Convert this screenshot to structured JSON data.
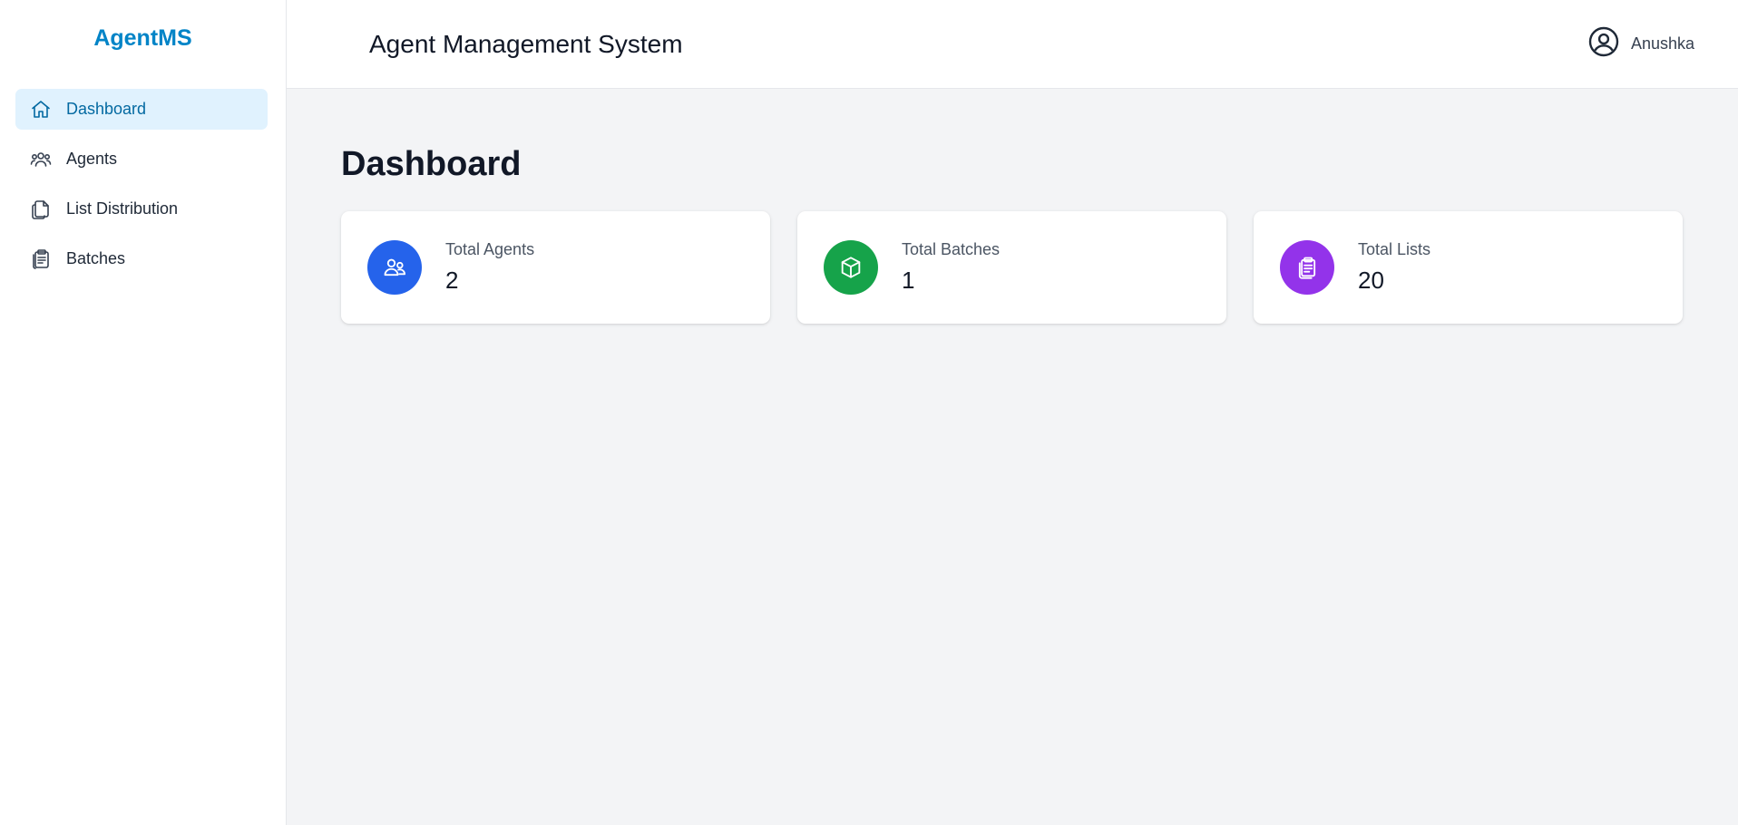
{
  "brand": "AgentMS",
  "sidebar": {
    "items": [
      {
        "label": "Dashboard",
        "icon": "home-icon",
        "active": true
      },
      {
        "label": "Agents",
        "icon": "users-icon",
        "active": false
      },
      {
        "label": "List Distribution",
        "icon": "documents-icon",
        "active": false
      },
      {
        "label": "Batches",
        "icon": "clipboard-icon",
        "active": false
      }
    ]
  },
  "header": {
    "title": "Agent Management System",
    "user_name": "Anushka"
  },
  "page": {
    "title": "Dashboard",
    "cards": [
      {
        "label": "Total Agents",
        "value": "2",
        "icon": "users-icon",
        "color": "#2563eb"
      },
      {
        "label": "Total Batches",
        "value": "1",
        "icon": "cube-icon",
        "color": "#16a34a"
      },
      {
        "label": "Total Lists",
        "value": "20",
        "icon": "clipboard-icon",
        "color": "#9333ea"
      }
    ]
  },
  "colors": {
    "accent": "#0284c7",
    "active_bg": "#e0f2fe",
    "background": "#f3f4f6"
  }
}
